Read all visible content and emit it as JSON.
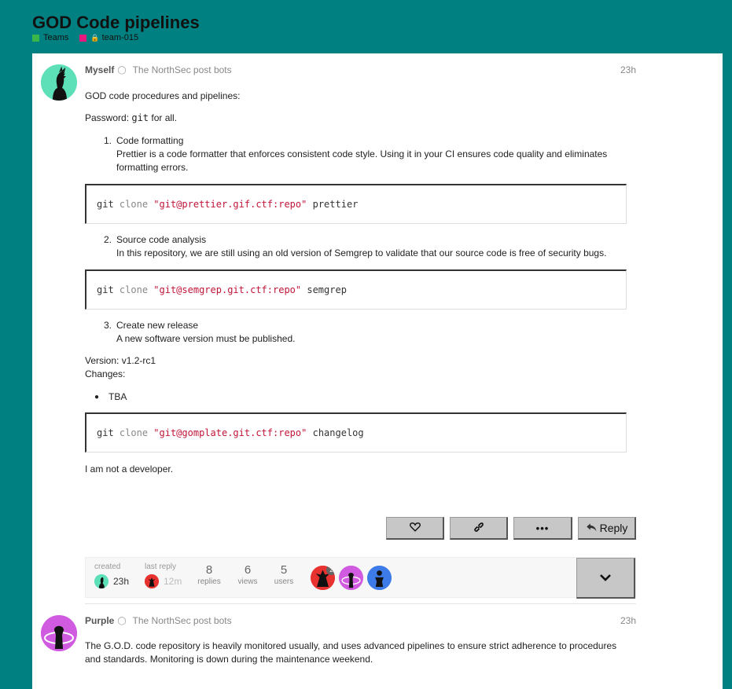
{
  "topic": {
    "title": "GOD Code pipelines",
    "categories": [
      {
        "label": "Teams",
        "color": "#3ab54a",
        "locked": false
      },
      {
        "label": "team-015",
        "color": "#e6177f",
        "locked": true
      }
    ]
  },
  "post1": {
    "username": "Myself",
    "group": "The NorthSec post bots",
    "time": "23h",
    "intro": "GOD code procedures and pipelines:",
    "password_prefix": "Password: ",
    "password_code": "git",
    "password_suffix": " for all.",
    "steps": [
      {
        "num": "1.",
        "title": "Code formatting",
        "desc": "Prettier is a code formatter that enforces consistent code style. Using it in your CI ensures code quality and eliminates formatting errors.",
        "code": {
          "cmd": "git",
          "sub": "clone",
          "url": "\"git@prettier.gif.ctf:repo\"",
          "dir": "prettier"
        }
      },
      {
        "num": "2.",
        "title": "Source code analysis",
        "desc": "In this repository, we are still using an old version of Semgrep to validate that our source code is free of security bugs.",
        "code": {
          "cmd": "git",
          "sub": "clone",
          "url": "\"git@semgrep.git.ctf:repo\"",
          "dir": "semgrep"
        }
      },
      {
        "num": "3.",
        "title": "Create new release",
        "desc": "A new software version must be published."
      }
    ],
    "version_line": "Version: v1.2-rc1",
    "changes_line": "Changes:",
    "bullet": "TBA",
    "code3": {
      "cmd": "git",
      "sub": "clone",
      "url": "\"git@gomplate.git.ctf:repo\"",
      "dir": "changelog"
    },
    "closing": "I am not a developer.",
    "reply_label": "Reply"
  },
  "summary": {
    "created_label": "created",
    "created_time": "23h",
    "last_reply_label": "last reply",
    "last_reply_time": "12m",
    "replies_num": "8",
    "replies_label": "replies",
    "views_num": "6",
    "views_label": "views",
    "users_num": "5",
    "users_label": "users",
    "participant_badge": "2"
  },
  "post2": {
    "username": "Purple",
    "group": "The NorthSec post bots",
    "time": "23h",
    "text": "The G.O.D. code repository is heavily monitored usually, and uses advanced pipelines to ensure strict adherence to procedures and standards. Monitoring is down during the maintenance weekend."
  },
  "icons": {
    "like": "heart-icon",
    "link": "link-icon",
    "more": "ellipsis-icon",
    "reply": "reply-arrow-icon",
    "expand": "chevron-down-icon",
    "shield": "shield-icon"
  }
}
